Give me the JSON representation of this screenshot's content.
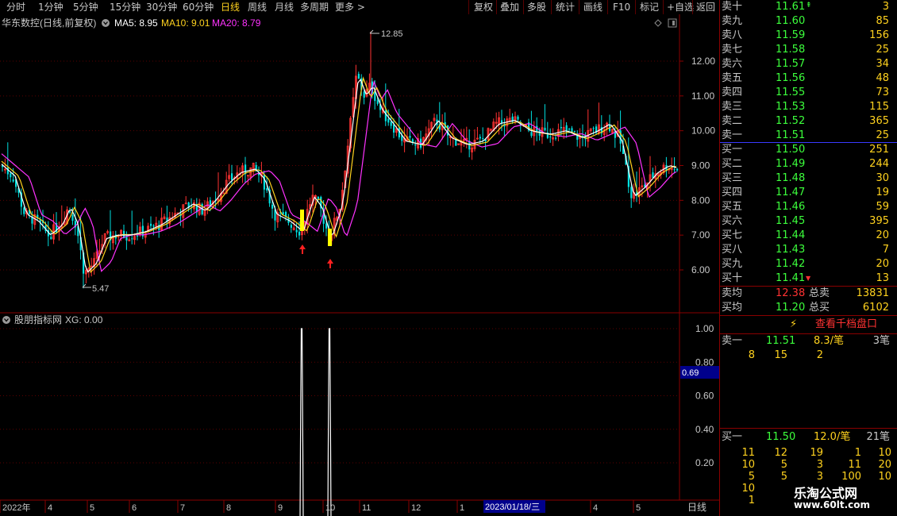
{
  "toolbar": {
    "left": [
      "分时",
      "1分钟",
      "5分钟",
      "15分钟",
      "30分钟",
      "60分钟",
      "日线",
      "周线",
      "月线",
      "多周期",
      "更多 >"
    ],
    "active": "日线",
    "right": [
      "复权",
      "叠加",
      "多股",
      "统计",
      "画线",
      "F10",
      "标记",
      "+自选",
      "返回"
    ]
  },
  "header": {
    "stock": "华东数控(日线,前复权)",
    "ma5": "MA5: 8.95",
    "ma10": "MA10: 9.01",
    "ma20": "MA20: 8.79"
  },
  "price_axis": [
    "12.00",
    "11.00",
    "10.00",
    "9.00",
    "8.00",
    "7.00",
    "6.00"
  ],
  "annotations": {
    "high": "12.85",
    "low": "5.47"
  },
  "indicator": {
    "title": "股朋指标网",
    "value": "XG: 0.00",
    "axis": [
      "1.00",
      "0.80",
      "0.60",
      "0.40",
      "0.20"
    ],
    "cursor_value": "0.69"
  },
  "time_axis": {
    "labels": [
      "2022年",
      "4",
      "5",
      "6",
      "7",
      "8",
      "9",
      "10",
      "11",
      "12",
      "1",
      "4",
      "5"
    ],
    "cursor_date": "2023/01/18/三",
    "period": "日线"
  },
  "colors": {
    "up": "#ff3232",
    "down": "#00e0e0",
    "ma5": "#ffffff",
    "ma10": "#ffd21e",
    "ma20": "#ff32ff",
    "signal": "#ffff00"
  },
  "chart_data": {
    "type": "line",
    "title": "华东数控(日线,前复权)",
    "x": [
      "2022年",
      "4",
      "5",
      "6",
      "7",
      "8",
      "9",
      "10",
      "11",
      "12",
      "1",
      "4",
      "5"
    ],
    "series": [
      {
        "name": "MA5",
        "values": [
          8.8,
          7.2,
          6.0,
          7.0,
          7.9,
          8.9,
          7.4,
          7.0,
          11.3,
          10.1,
          9.7,
          10.1,
          8.95
        ]
      },
      {
        "name": "MA10",
        "values": [
          8.7,
          7.4,
          6.3,
          6.9,
          7.8,
          8.8,
          7.6,
          7.3,
          11.0,
          10.2,
          9.8,
          10.1,
          9.01
        ]
      },
      {
        "name": "MA20",
        "values": [
          8.6,
          7.8,
          6.7,
          6.8,
          7.6,
          8.6,
          7.9,
          7.6,
          10.5,
          10.3,
          9.9,
          10.1,
          8.79
        ]
      },
      {
        "name": "XG",
        "values": [
          0,
          0,
          0,
          0,
          0,
          0,
          0,
          1,
          0,
          0,
          0,
          0,
          0
        ]
      }
    ],
    "ylim": [
      5.2,
      13.0
    ],
    "high": 12.85,
    "low": 5.47
  },
  "orderbook": {
    "asks": [
      {
        "label": "卖十",
        "price": "11.61",
        "vol": "3"
      },
      {
        "label": "卖九",
        "price": "11.60",
        "vol": "85"
      },
      {
        "label": "卖八",
        "price": "11.59",
        "vol": "156"
      },
      {
        "label": "卖七",
        "price": "11.58",
        "vol": "25"
      },
      {
        "label": "卖六",
        "price": "11.57",
        "vol": "34"
      },
      {
        "label": "卖五",
        "price": "11.56",
        "vol": "48"
      },
      {
        "label": "卖四",
        "price": "11.55",
        "vol": "73"
      },
      {
        "label": "卖三",
        "price": "11.53",
        "vol": "115"
      },
      {
        "label": "卖二",
        "price": "11.52",
        "vol": "365"
      },
      {
        "label": "卖一",
        "price": "11.51",
        "vol": "25"
      }
    ],
    "bids": [
      {
        "label": "买一",
        "price": "11.50",
        "vol": "251"
      },
      {
        "label": "买二",
        "price": "11.49",
        "vol": "244"
      },
      {
        "label": "买三",
        "price": "11.48",
        "vol": "30"
      },
      {
        "label": "买四",
        "price": "11.47",
        "vol": "19"
      },
      {
        "label": "买五",
        "price": "11.46",
        "vol": "59"
      },
      {
        "label": "买六",
        "price": "11.45",
        "vol": "395"
      },
      {
        "label": "买七",
        "price": "11.44",
        "vol": "20"
      },
      {
        "label": "买八",
        "price": "11.43",
        "vol": "7"
      },
      {
        "label": "买九",
        "price": "11.42",
        "vol": "20"
      },
      {
        "label": "买十",
        "price": "11.41",
        "vol": "13"
      }
    ],
    "summary": [
      {
        "label": "卖均",
        "price": "12.38",
        "label2": "总卖",
        "vol": "13831"
      },
      {
        "label": "买均",
        "price": "11.20",
        "label2": "总买",
        "vol": "6102"
      }
    ],
    "view_all": "查看千档盘口",
    "sell1": {
      "label": "卖一",
      "price": "11.51",
      "avg": "8.3/笔",
      "count": "3笔",
      "queue": [
        "8",
        "15",
        "2"
      ]
    },
    "buy1": {
      "label": "买一",
      "price": "11.50",
      "avg": "12.0/笔",
      "count": "21笔",
      "queue": [
        [
          "11",
          "12",
          "19",
          "1",
          "10"
        ],
        [
          "10",
          "5",
          "3",
          "11",
          "20"
        ],
        [
          "5",
          "5",
          "3",
          "100",
          "10"
        ],
        [
          "10"
        ],
        [
          "1"
        ]
      ]
    }
  },
  "watermark": {
    "name": "乐淘公式网",
    "url": "www.60lt.com"
  }
}
